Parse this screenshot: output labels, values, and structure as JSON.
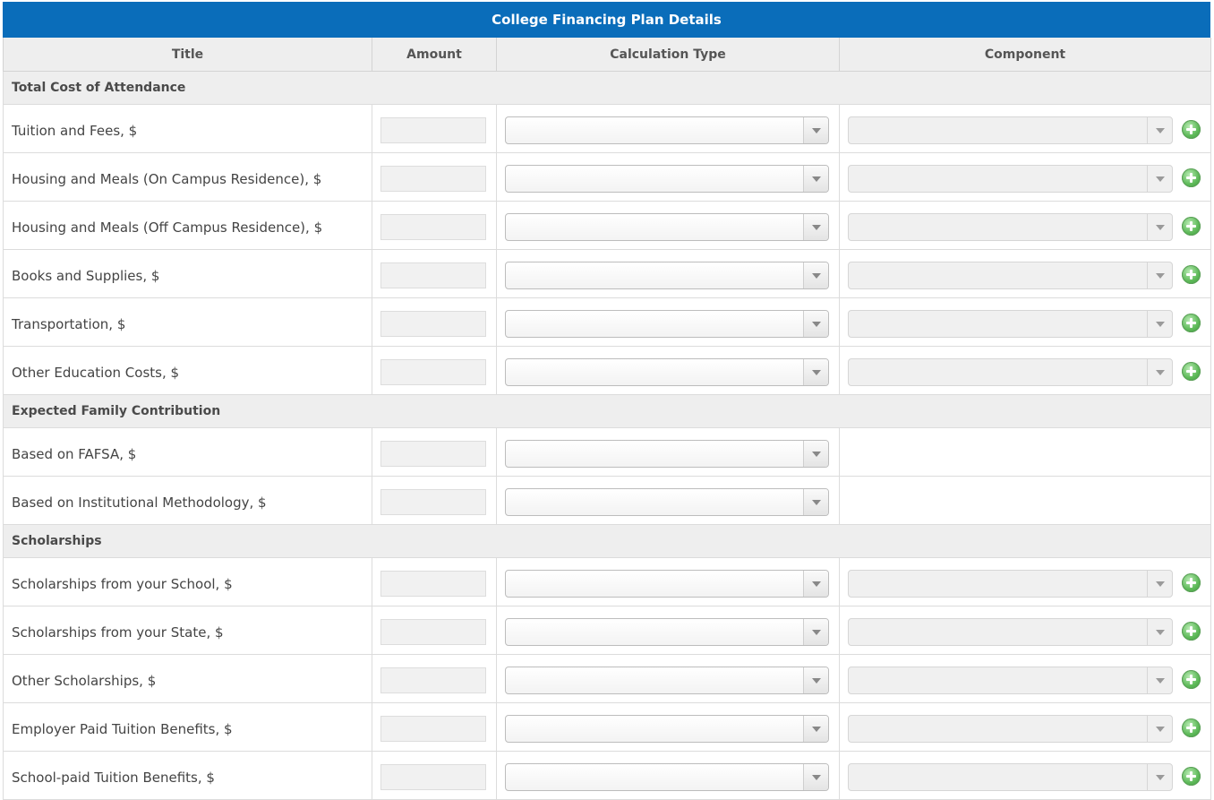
{
  "panel": {
    "title": "College Financing Plan Details"
  },
  "columns": {
    "title": "Title",
    "amount": "Amount",
    "calc_type": "Calculation Type",
    "component": "Component"
  },
  "sections": [
    {
      "name": "Total Cost of Attendance",
      "has_component": true,
      "rows": [
        {
          "label": "Tuition and Fees, $",
          "amount": "",
          "calc_type": "",
          "component": ""
        },
        {
          "label": "Housing and Meals (On Campus Residence), $",
          "amount": "",
          "calc_type": "",
          "component": ""
        },
        {
          "label": "Housing and Meals (Off Campus Residence), $",
          "amount": "",
          "calc_type": "",
          "component": ""
        },
        {
          "label": "Books and Supplies, $",
          "amount": "",
          "calc_type": "",
          "component": ""
        },
        {
          "label": "Transportation, $",
          "amount": "",
          "calc_type": "",
          "component": ""
        },
        {
          "label": "Other Education Costs, $",
          "amount": "",
          "calc_type": "",
          "component": ""
        }
      ]
    },
    {
      "name": "Expected Family Contribution",
      "has_component": false,
      "rows": [
        {
          "label": "Based on FAFSA, $",
          "amount": "",
          "calc_type": ""
        },
        {
          "label": "Based on Institutional Methodology, $",
          "amount": "",
          "calc_type": ""
        }
      ]
    },
    {
      "name": "Scholarships",
      "has_component": true,
      "rows": [
        {
          "label": "Scholarships from your School, $",
          "amount": "",
          "calc_type": "",
          "component": ""
        },
        {
          "label": "Scholarships from your State, $",
          "amount": "",
          "calc_type": "",
          "component": ""
        },
        {
          "label": "Other Scholarships, $",
          "amount": "",
          "calc_type": "",
          "component": ""
        },
        {
          "label": "Employer Paid Tuition Benefits, $",
          "amount": "",
          "calc_type": "",
          "component": ""
        },
        {
          "label": "School-paid Tuition Benefits, $",
          "amount": "",
          "calc_type": "",
          "component": ""
        }
      ]
    }
  ],
  "icons": {
    "add": "plus-circle-icon",
    "dropdown": "chevron-down-icon"
  },
  "colors": {
    "header_bar": "#0a6dba",
    "add_icon": "#5fba5a",
    "section_bg": "#eeeeee"
  }
}
